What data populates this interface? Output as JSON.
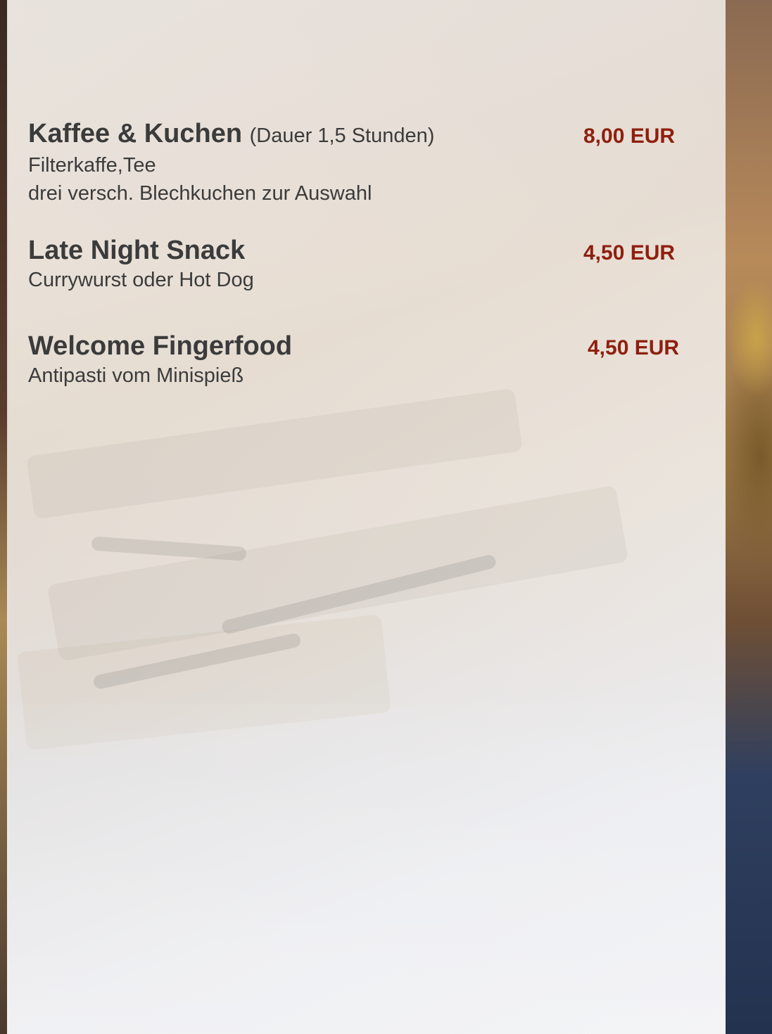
{
  "menu": {
    "items": [
      {
        "title": "Kaffee & Kuchen",
        "duration": "(Dauer 1,5 Stunden)",
        "description": [
          "Filterkaffe,Tee",
          "drei versch. Blechkuchen zur Auswahl"
        ],
        "price": "8,00 EUR"
      },
      {
        "title": "Late Night Snack",
        "duration": "",
        "description": [
          "Currywurst oder Hot Dog"
        ],
        "price": "4,50 EUR"
      },
      {
        "title": "Welcome Fingerfood",
        "duration": "",
        "description": [
          "Antipasti vom Minispieß"
        ],
        "price": "4,50 EUR"
      }
    ]
  },
  "colors": {
    "text": "#3b3b3b",
    "price": "#8f1f0e",
    "panel": "#f0ece8"
  }
}
